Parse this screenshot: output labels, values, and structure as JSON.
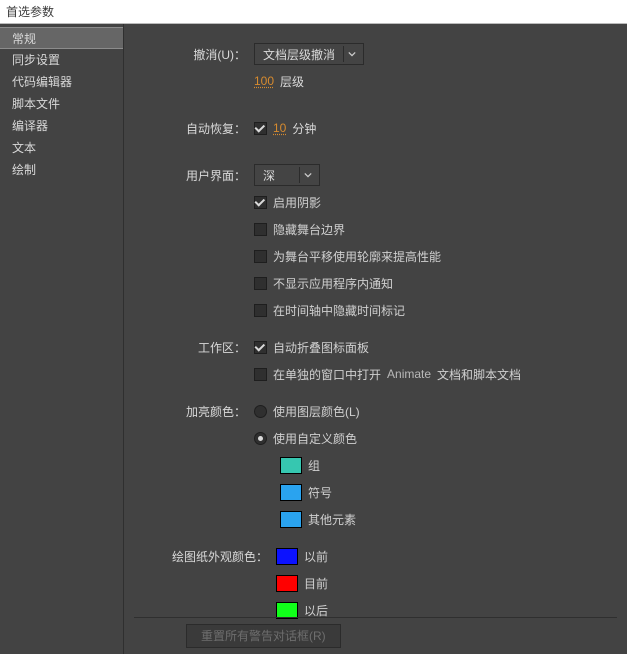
{
  "window": {
    "title": "首选参数"
  },
  "sidebar": {
    "items": [
      {
        "label": "常规"
      },
      {
        "label": "同步设置"
      },
      {
        "label": "代码编辑器"
      },
      {
        "label": "脚本文件"
      },
      {
        "label": "编译器"
      },
      {
        "label": "文本"
      },
      {
        "label": "绘制"
      }
    ],
    "activeIndex": 0
  },
  "general": {
    "undo": {
      "label": "撤消(U)：",
      "select_value": "文档层级撤消",
      "levels_value": "100",
      "levels_unit": "层级"
    },
    "auto_recovery": {
      "label": "自动恢复：",
      "checked": true,
      "value": "10",
      "unit": "分钟"
    },
    "ui": {
      "label": "用户界面：",
      "theme_value": "深",
      "opts": [
        {
          "label": "启用阴影",
          "checked": true
        },
        {
          "label": "隐藏舞台边界",
          "checked": false
        },
        {
          "label": "为舞台平移使用轮廓来提高性能",
          "checked": false
        },
        {
          "label": "不显示应用程序内通知",
          "checked": false
        },
        {
          "label": "在时间轴中隐藏时间标记",
          "checked": false
        }
      ]
    },
    "workspace": {
      "label": "工作区：",
      "opts": [
        {
          "label": "自动折叠图标面板",
          "checked": true
        },
        {
          "label_prefix": "在单独的窗口中打开",
          "label_suffix": "文档和脚本文档",
          "app": "Animate",
          "checked": false
        }
      ]
    },
    "highlight": {
      "label": "加亮颜色：",
      "radios": [
        {
          "label": "使用图层颜色(L)",
          "checked": false
        },
        {
          "label": "使用自定义颜色",
          "checked": true
        }
      ],
      "swatches": [
        {
          "color": "#36c7b0",
          "label": "组"
        },
        {
          "color": "#2aa3ef",
          "label": "符号"
        },
        {
          "color": "#2aa3ef",
          "label": "其他元素"
        }
      ]
    },
    "onion": {
      "label": "绘图纸外观颜色：",
      "swatches": [
        {
          "color": "#0c12ff",
          "label": "以前"
        },
        {
          "color": "#ff0000",
          "label": "目前"
        },
        {
          "color": "#11ff1a",
          "label": "以后"
        }
      ]
    },
    "reset_button": "重置所有警告对话框(R)"
  }
}
